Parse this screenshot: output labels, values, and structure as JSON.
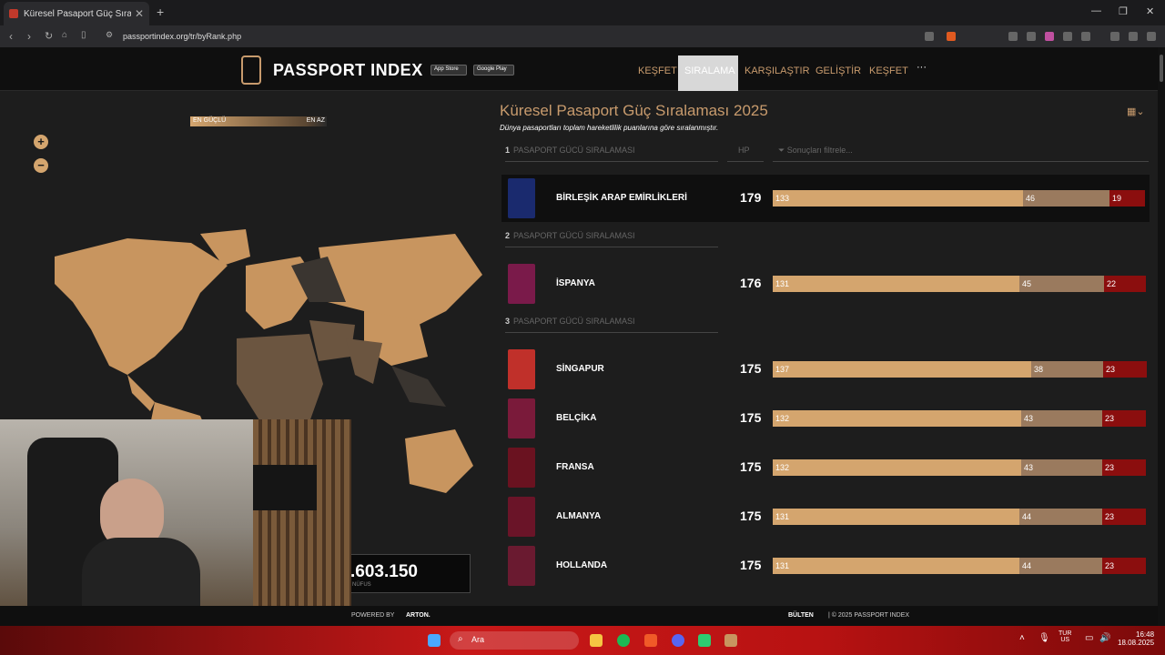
{
  "browser": {
    "tab_title": "Küresel Pasaport Güç Sıralaması",
    "url": "passportindex.org/tr/byRank.php"
  },
  "site": {
    "logo_text": "PASSPORT INDEX",
    "app_store": "App Store",
    "google_play": "Google Play",
    "nav": [
      "KEŞFET",
      "SIRALAMA",
      "KARŞILAŞTIR",
      "GELİŞTİR",
      "KEŞFET",
      "···"
    ]
  },
  "map": {
    "legend_strong": "EN GÜÇLÜ",
    "legend_weak": "EN AZ",
    "zoom_in": "+",
    "zoom_out": "−",
    "population": ".603.150",
    "population_label": "NÜFUS"
  },
  "ranking": {
    "title": "Küresel Pasaport Güç Sıralaması 2025",
    "subtitle": "Dünya pasaportları toplam hareketlilik puanlarına göre sıralanmıştır.",
    "hp_header": "HP",
    "filter_placeholder": "Sonuçları filtrele...",
    "groups": [
      {
        "rank": "1",
        "label": "PASAPORT GÜCÜ SIRALAMASI"
      },
      {
        "rank": "2",
        "label": "PASAPORT GÜCÜ SIRALAMASI"
      },
      {
        "rank": "3",
        "label": "PASAPORT GÜCÜ SIRALAMASI"
      }
    ],
    "rows": [
      {
        "country": "BİRLEŞİK ARAP EMİRLİKLERİ",
        "score": "179",
        "a": 133,
        "b": 46,
        "c": 19,
        "color": "#1a2a6e"
      },
      {
        "country": "İSPANYA",
        "score": "176",
        "a": 131,
        "b": 45,
        "c": 22,
        "color": "#7a1a4a"
      },
      {
        "country": "SİNGAPUR",
        "score": "175",
        "a": 137,
        "b": 38,
        "c": 23,
        "color": "#c0302a"
      },
      {
        "country": "BELÇİKA",
        "score": "175",
        "a": 132,
        "b": 43,
        "c": 23,
        "color": "#7a1a3a"
      },
      {
        "country": "FRANSA",
        "score": "175",
        "a": 132,
        "b": 43,
        "c": 23,
        "color": "#6a1220"
      },
      {
        "country": "ALMANYA",
        "score": "175",
        "a": 131,
        "b": 44,
        "c": 23,
        "color": "#6a1428"
      },
      {
        "country": "HOLLANDA",
        "score": "175",
        "a": 131,
        "b": 44,
        "c": 23,
        "color": "#6a1a30"
      }
    ]
  },
  "footer": {
    "powered": "POWERED BY",
    "brand": "ARTON.",
    "bulletin": "BÜLTEN",
    "copyright": "| © 2025 PASSPORT INDEX"
  },
  "taskbar": {
    "search": "Ara",
    "lang_top": "TUR",
    "lang_bottom": "US",
    "time": "16:48",
    "date": "18.08.2025"
  }
}
